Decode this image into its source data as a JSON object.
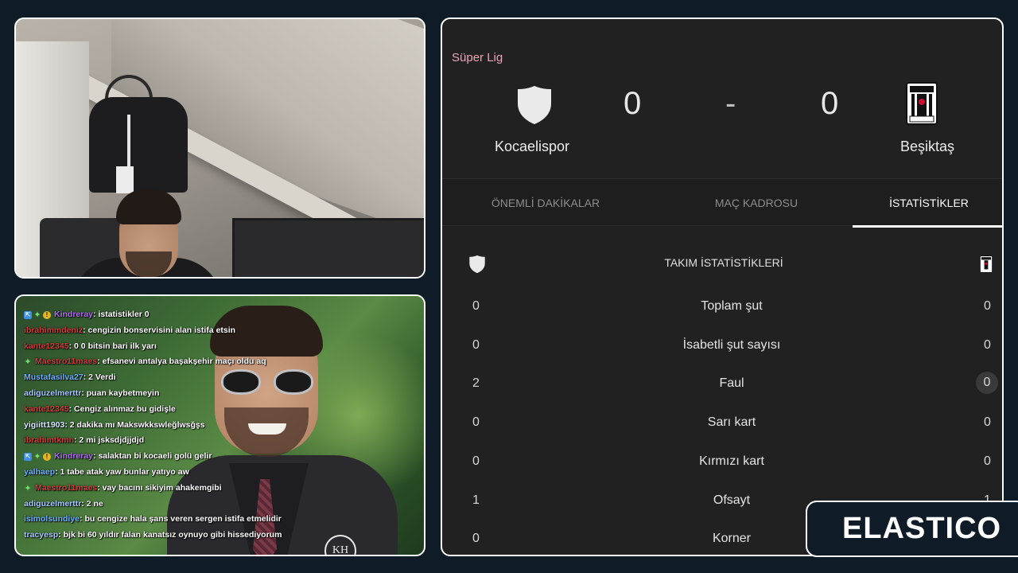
{
  "scoreboard": {
    "league": "Süper Lig",
    "home": {
      "name": "Kocaelispor",
      "score": "0"
    },
    "away": {
      "name": "Beşiktaş",
      "score": "0"
    },
    "separator": "-",
    "tabs": [
      "ÖNEMLİ DAKİKALAR",
      "MAÇ KADROSU",
      "İSTATİSTİKLER"
    ],
    "active_tab": "İSTATİSTİKLER",
    "stats_title": "TAKIM İSTATİSTİKLERİ",
    "stats": [
      {
        "label": "Toplam şut",
        "home": "0",
        "away": "0"
      },
      {
        "label": "İsabetli şut sayısı",
        "home": "0",
        "away": "0"
      },
      {
        "label": "Faul",
        "home": "2",
        "away": "0"
      },
      {
        "label": "Sarı kart",
        "home": "0",
        "away": "0"
      },
      {
        "label": "Kırmızı kart",
        "home": "0",
        "away": "0"
      },
      {
        "label": "Ofsayt",
        "home": "1",
        "away": "1"
      },
      {
        "label": "Korner",
        "home": "0",
        "away": ""
      }
    ],
    "colors": {
      "league": "#e9a6b8",
      "panel": "#212121",
      "text": "#e8e8e8"
    }
  },
  "chat": {
    "messages": [
      {
        "user": "",
        "color": "#e04a4a",
        "text": "",
        "badges": false
      },
      {
        "user": "Kindreray",
        "color": "#b06cf0",
        "text": "istatistikler 0",
        "badges": true
      },
      {
        "user": "ibrahimmdeniz",
        "color": "#d23a3a",
        "text": "cengizin bonservisini alan istifa etsin",
        "badges": false
      },
      {
        "user": "kante12345",
        "color": "#d23a3a",
        "text": "0 0 bitsin bari ilk yarı",
        "badges": false
      },
      {
        "user": "Maestro11maes",
        "color": "#d23a3a",
        "text": "efsanevi antalya başakşehir maçı oldu aq",
        "badges": "green"
      },
      {
        "user": "Mustafasilva27",
        "color": "#6ab0ff",
        "text": "2 Verdi",
        "badges": false
      },
      {
        "user": "adiguzelmerttr",
        "color": "#a6c8ff",
        "text": "puan kaybetmeyin",
        "badges": false
      },
      {
        "user": "kante12345",
        "color": "#d23a3a",
        "text": "Cengiz alınmaz bu gidişle",
        "badges": false
      },
      {
        "user": "yigiitt1903",
        "color": "#d8e8ff",
        "text": "2 dakika mı Makswkkswleğlwsğşs",
        "badges": false
      },
      {
        "user": "ibrahimtkmn",
        "color": "#d23a3a",
        "text": "2 mi jsksdjdjjdjd",
        "badges": false
      },
      {
        "user": "Kindreray",
        "color": "#b06cf0",
        "text": "salaktan bi kocaeli golü gelir",
        "badges": true
      },
      {
        "user": "yalhaep",
        "color": "#6ab0ff",
        "text": "1 tabe atak yaw bunlar yatıyo aw",
        "badges": false
      },
      {
        "user": "Maestro11maes",
        "color": "#d23a3a",
        "text": "vay bacını sikiyim ahakemgibi",
        "badges": "green"
      },
      {
        "user": "adiguzelmerttr",
        "color": "#a6c8ff",
        "text": "2 ne",
        "badges": false
      },
      {
        "user": "isimolsundiye",
        "color": "#6ab0ff",
        "text": "bu cengize hala şans veren sergen istifa etmelidir",
        "badges": false
      },
      {
        "user": "tracyesp",
        "color": "#a6c8ff",
        "text": "bjk bi 60 yıldır falan kanatsız oynuyo gibi hissediyorum",
        "badges": false
      }
    ]
  },
  "brand": {
    "text": "ELASTICO"
  },
  "icons": {
    "home_crest": "shield-icon",
    "away_crest": "bjk-crest-icon",
    "chat_badge_1": "twitch-badge-icon",
    "chat_badge_2": "sparkle-icon",
    "chat_badge_3": "coin-icon"
  }
}
